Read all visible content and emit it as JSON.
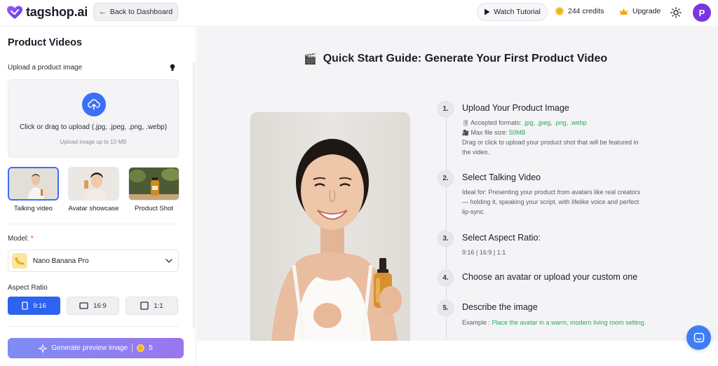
{
  "header": {
    "logo_text": "tagshop.ai",
    "back_label": "Back to Dashboard",
    "watch_label": "Watch Tutorial",
    "credits": "244 credits",
    "upgrade_label": "Upgrade",
    "avatar_initial": "P"
  },
  "sidebar": {
    "title": "Product Videos",
    "upload_label": "Upload a product image",
    "upload_main": "Click or drag to upload (.jpg, .jpeg, .png, .webp)",
    "upload_sub": "Upload image up to 10 MB",
    "types": [
      {
        "label": "Talking video",
        "selected": true
      },
      {
        "label": "Avatar showcase",
        "selected": false
      },
      {
        "label": "Product Shot",
        "selected": false
      }
    ],
    "model_label": "Model:",
    "model_required": "*",
    "model_value": "Nano Banana Pro",
    "aspect_label": "Aspect Ratio",
    "aspects": [
      {
        "label": "9:16",
        "selected": true
      },
      {
        "label": "16:9",
        "selected": false
      },
      {
        "label": "1:1",
        "selected": false
      }
    ],
    "generate_label": "Generate preview image",
    "generate_cost": "5"
  },
  "guide": {
    "emoji": "🎬",
    "title": "Quick Start Guide: Generate Your First Product Video",
    "steps": [
      {
        "num": "1.",
        "title": "Upload Your Product Image",
        "formats_prefix": "Accepted formats: ",
        "formats": ".jpg, .jpeg, .png, .webp",
        "size_prefix": "Max file size: ",
        "size": "50MB",
        "line1": "Drag or click to upload your product shot that will be featured in",
        "line2": "the video."
      },
      {
        "num": "2.",
        "title": "Select Talking Video",
        "line1": "Ideal for: Presenting your product from avatars like real creators",
        "line2": "— holding it, speaking your script, with lifelike voice and perfect",
        "line3": "lip-sync."
      },
      {
        "num": "3.",
        "title": "Select Aspect Ratio:",
        "line1": "9:16 | 16:9 | 1:1"
      },
      {
        "num": "4.",
        "title": "Choose an avatar or upload your custom one"
      },
      {
        "num": "5.",
        "title": "Describe the image",
        "example_prefix": "Example : ",
        "example": "Place the avatar in a warm, modern living room setting."
      }
    ]
  },
  "colors": {
    "accent": "#3b6ff5",
    "purple": "#7b35e0",
    "green": "#27a85a"
  }
}
